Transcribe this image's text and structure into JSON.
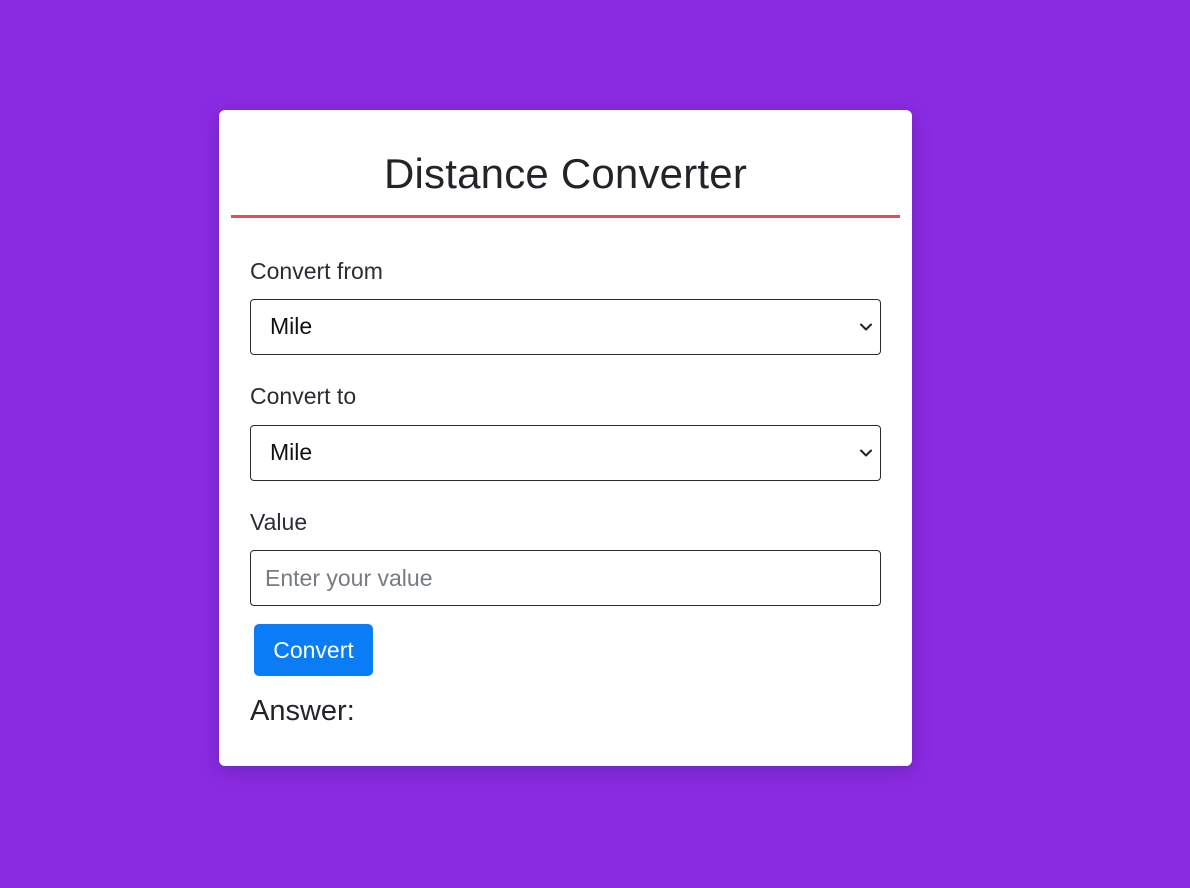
{
  "colors": {
    "background": "#8a2be2",
    "card": "#ffffff",
    "divider": "#e84a5a",
    "button": "#0a7cf5"
  },
  "card": {
    "title": "Distance Converter"
  },
  "form": {
    "from": {
      "label": "Convert from",
      "selected": "Mile",
      "icon": "chevron-down-icon"
    },
    "to": {
      "label": "Convert to",
      "selected": "Mile",
      "icon": "chevron-down-icon"
    },
    "value": {
      "label": "Value",
      "placeholder": "Enter your value",
      "current": ""
    },
    "convert_button": "Convert"
  },
  "result": {
    "label": "Answer:"
  }
}
